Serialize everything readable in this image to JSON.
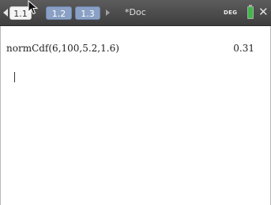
{
  "toolbar": {
    "tabs": [
      {
        "label": "1.1"
      },
      {
        "label": "1.2"
      },
      {
        "label": "1.3"
      }
    ],
    "doc_title": "*Doc",
    "angle_mode": "DEG",
    "battery_color": "#3fb94a",
    "close_glyph": "✕"
  },
  "calculator": {
    "entries": [
      {
        "expression": "normCdf(6,100,5.2,1.6)",
        "result": "0.31"
      }
    ]
  }
}
